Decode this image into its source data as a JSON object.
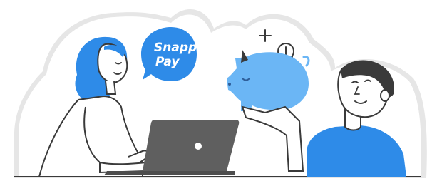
{
  "brand": {
    "line1": "Snapp!",
    "line2": "Pay"
  },
  "colors": {
    "brand_blue": "#2E8BE8",
    "light_blue": "#6BB6F5",
    "sticker_shadow": "#E6E6E6",
    "outline": "#3A3A3A",
    "laptop_gray": "#5F5F5F",
    "laptop_dark": "#4D4D4D"
  },
  "illustration": {
    "woman_with_laptop": "woman-with-laptop",
    "speech_bubble": "speech-bubble",
    "piggy_bank": "piggy-bank-icon",
    "coin": "coin-icon",
    "plus_sign": "plus-icon",
    "man_smiling": "man-smiling"
  }
}
